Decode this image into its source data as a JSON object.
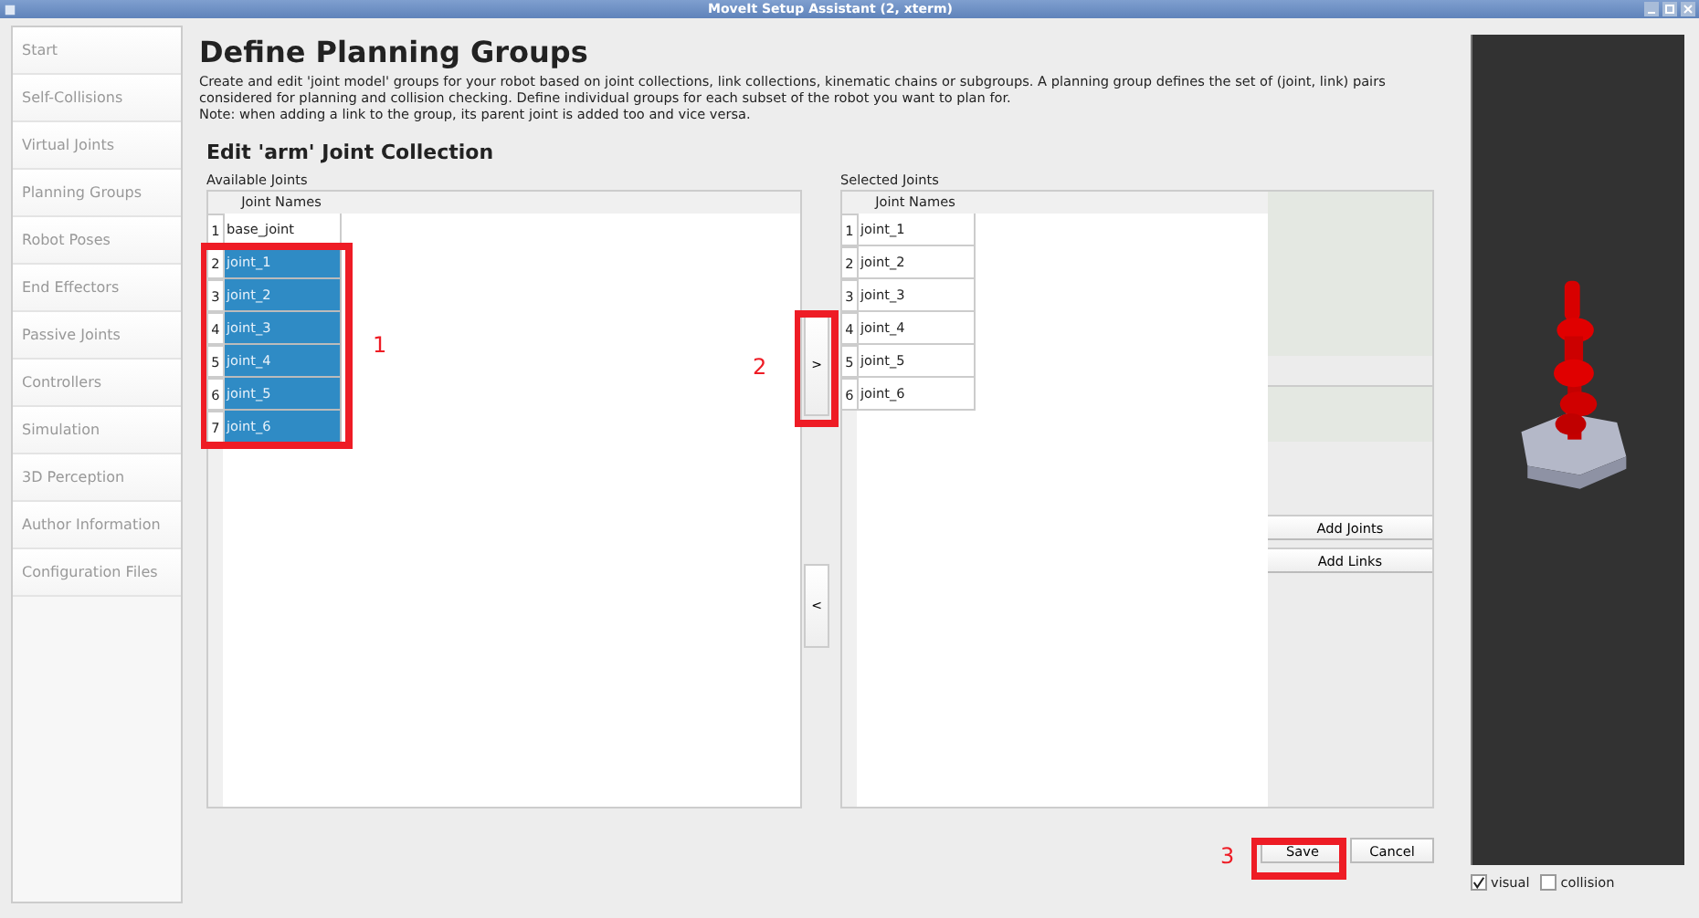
{
  "window": {
    "title": "MoveIt Setup Assistant (2, xterm)"
  },
  "sidebar": {
    "items": [
      {
        "label": "Start"
      },
      {
        "label": "Self-Collisions"
      },
      {
        "label": "Virtual Joints"
      },
      {
        "label": "Planning Groups"
      },
      {
        "label": "Robot Poses"
      },
      {
        "label": "End Effectors"
      },
      {
        "label": "Passive Joints"
      },
      {
        "label": "Controllers"
      },
      {
        "label": "Simulation"
      },
      {
        "label": "3D Perception"
      },
      {
        "label": "Author Information"
      },
      {
        "label": "Configuration Files"
      }
    ]
  },
  "page": {
    "title": "Define Planning Groups",
    "description": "Create and edit 'joint model' groups for your robot based on joint collections, link collections, kinematic chains or subgroups. A planning group defines the set of (joint, link) pairs considered for planning and collision checking. Define individual groups for each subset of the robot you want to plan for.",
    "note": "Note: when adding a link to the group, its parent joint is added too and vice versa.",
    "section_title": "Edit 'arm' Joint Collection"
  },
  "available": {
    "label": "Available Joints",
    "column": "Joint Names",
    "rows": [
      {
        "index": "1",
        "name": "base_joint",
        "selected": false
      },
      {
        "index": "2",
        "name": "joint_1",
        "selected": true
      },
      {
        "index": "3",
        "name": "joint_2",
        "selected": true
      },
      {
        "index": "4",
        "name": "joint_3",
        "selected": true
      },
      {
        "index": "5",
        "name": "joint_4",
        "selected": true
      },
      {
        "index": "6",
        "name": "joint_5",
        "selected": true
      },
      {
        "index": "7",
        "name": "joint_6",
        "selected": true
      }
    ]
  },
  "move_buttons": [
    ">",
    "<"
  ],
  "selected": {
    "label": "Selected Joints",
    "column": "Joint Names",
    "rows": [
      {
        "index": "1",
        "name": "joint_1",
        "selected": false
      },
      {
        "index": "2",
        "name": "joint_2",
        "selected": false
      },
      {
        "index": "3",
        "name": "joint_3",
        "selected": false
      },
      {
        "index": "4",
        "name": "joint_4",
        "selected": false
      },
      {
        "index": "5",
        "name": "joint_5",
        "selected": false
      },
      {
        "index": "6",
        "name": "joint_6",
        "selected": false
      }
    ]
  },
  "side_buttons": [
    "Add Joints",
    "Add Links"
  ],
  "buttons": [
    "Save",
    "Cancel"
  ],
  "viewer": {
    "options": [
      {
        "label": "visual",
        "checked": true
      },
      {
        "label": "collision",
        "checked": false
      }
    ]
  },
  "annotations": [
    {
      "label": "1"
    },
    {
      "label": "2"
    },
    {
      "label": "3"
    }
  ]
}
